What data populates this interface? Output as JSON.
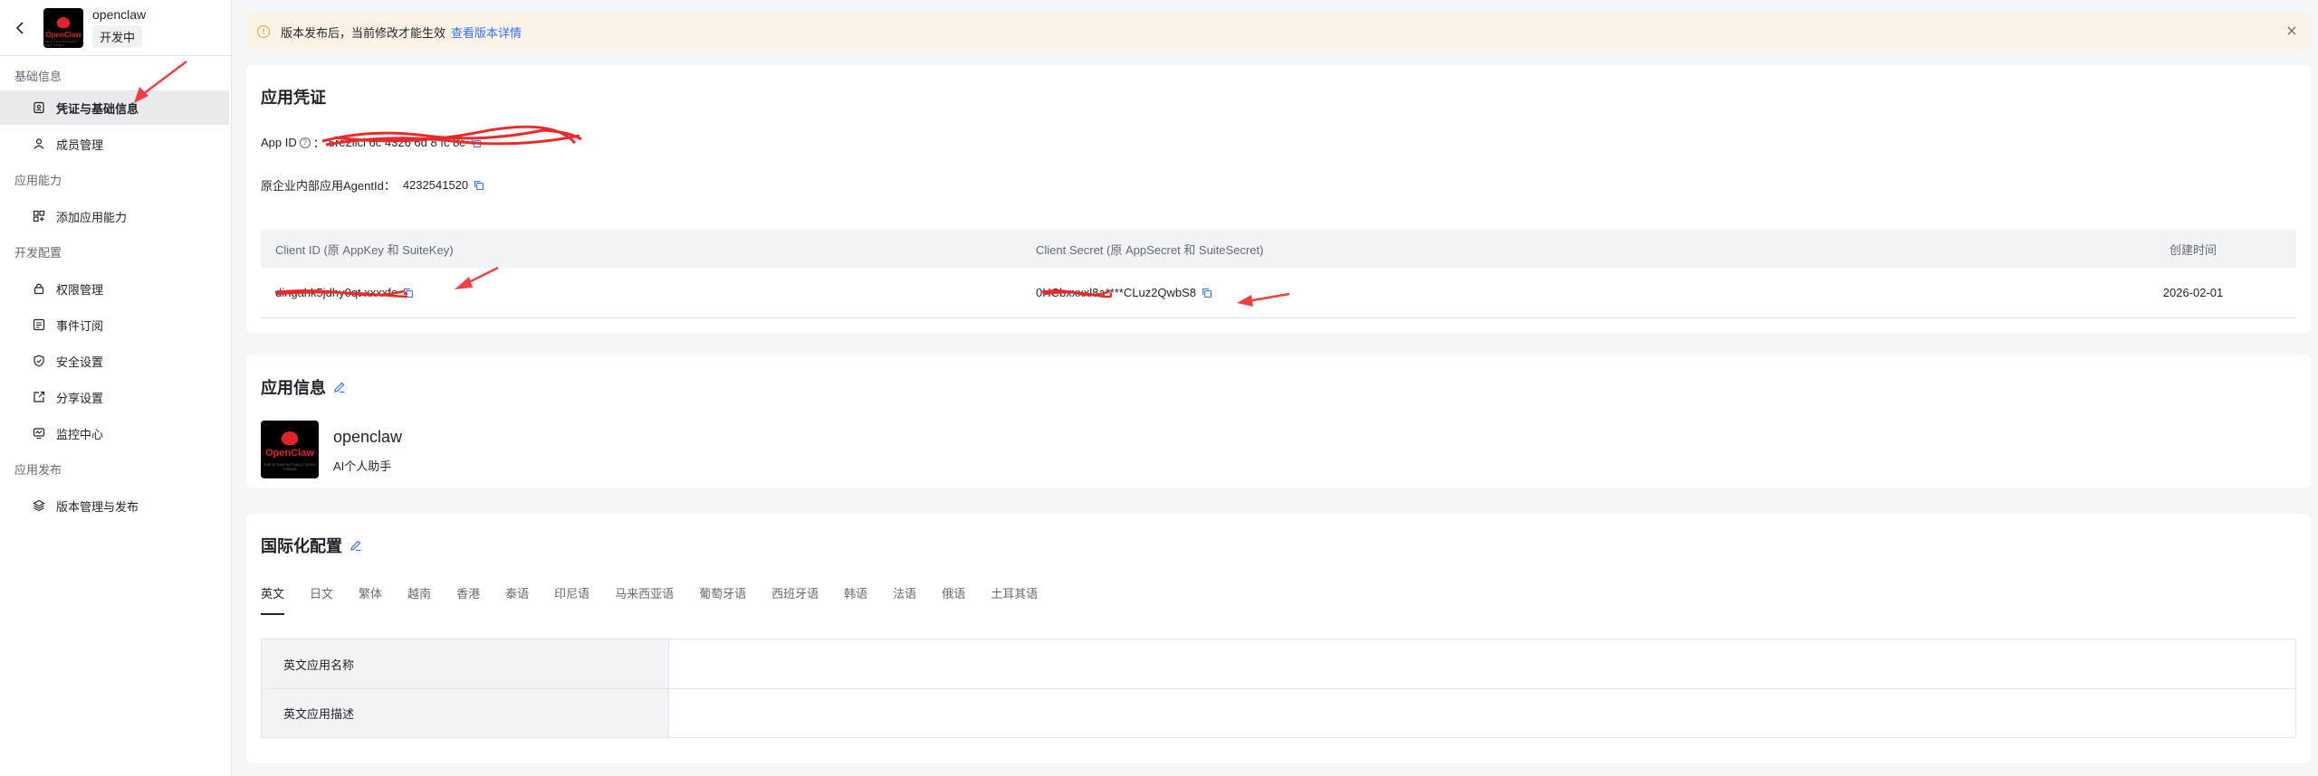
{
  "app": {
    "name": "openclaw",
    "status": "开发中",
    "logo_text": "OpenClaw",
    "logo_subtext": "THE AI THAT ACTUALLY DOES THINGS"
  },
  "sidebar": {
    "groups": [
      {
        "title": "基础信息",
        "items": [
          {
            "label": "凭证与基础信息",
            "icon": "credential-icon"
          },
          {
            "label": "成员管理",
            "icon": "user-icon"
          }
        ]
      },
      {
        "title": "应用能力",
        "items": [
          {
            "label": "添加应用能力",
            "icon": "grid-plus-icon"
          }
        ]
      },
      {
        "title": "开发配置",
        "items": [
          {
            "label": "权限管理",
            "icon": "lock-icon"
          },
          {
            "label": "事件订阅",
            "icon": "event-icon"
          },
          {
            "label": "安全设置",
            "icon": "shield-icon"
          },
          {
            "label": "分享设置",
            "icon": "share-icon"
          },
          {
            "label": "监控中心",
            "icon": "monitor-icon"
          }
        ]
      },
      {
        "title": "应用发布",
        "items": [
          {
            "label": "版本管理与发布",
            "icon": "layers-icon"
          }
        ]
      }
    ]
  },
  "banner": {
    "text": "版本发布后，当前修改才能生效",
    "link": "查看版本详情",
    "color": "#fbf3e5"
  },
  "credentials": {
    "title": "应用凭证",
    "app_id_label": "App ID",
    "app_id_value": "5re2llcl  6c  4326 6d  8 fc  8c",
    "agent_label": "原企业内部应用AgentId：",
    "agent_value": "4232541520",
    "table": {
      "headers": [
        "Client ID (原 AppKey 和 SuiteKey)",
        "Client Secret (原 AppSecret 和 SuiteSecret)",
        "创建时间"
      ],
      "row": {
        "client_id": "dingahk5jdhy0qt xxxxfe",
        "client_secret": "0HCbxxxxl8a****CLuz2QwbS8",
        "created": "2026-02-01"
      }
    }
  },
  "app_info": {
    "title": "应用信息",
    "name": "openclaw",
    "desc": "AI个人助手"
  },
  "i18n": {
    "title": "国际化配置",
    "tabs": [
      "英文",
      "日文",
      "繁体",
      "越南",
      "香港",
      "泰语",
      "印尼语",
      "马来西亚语",
      "葡萄牙语",
      "西班牙语",
      "韩语",
      "法语",
      "俄语",
      "土耳其语"
    ],
    "fields": [
      {
        "label": "英文应用名称",
        "value": ""
      },
      {
        "label": "英文应用描述",
        "value": ""
      }
    ]
  },
  "colors": {
    "accent": "#3370ff",
    "annotation": "#f04040",
    "active_bg": "#e9eaeb"
  }
}
